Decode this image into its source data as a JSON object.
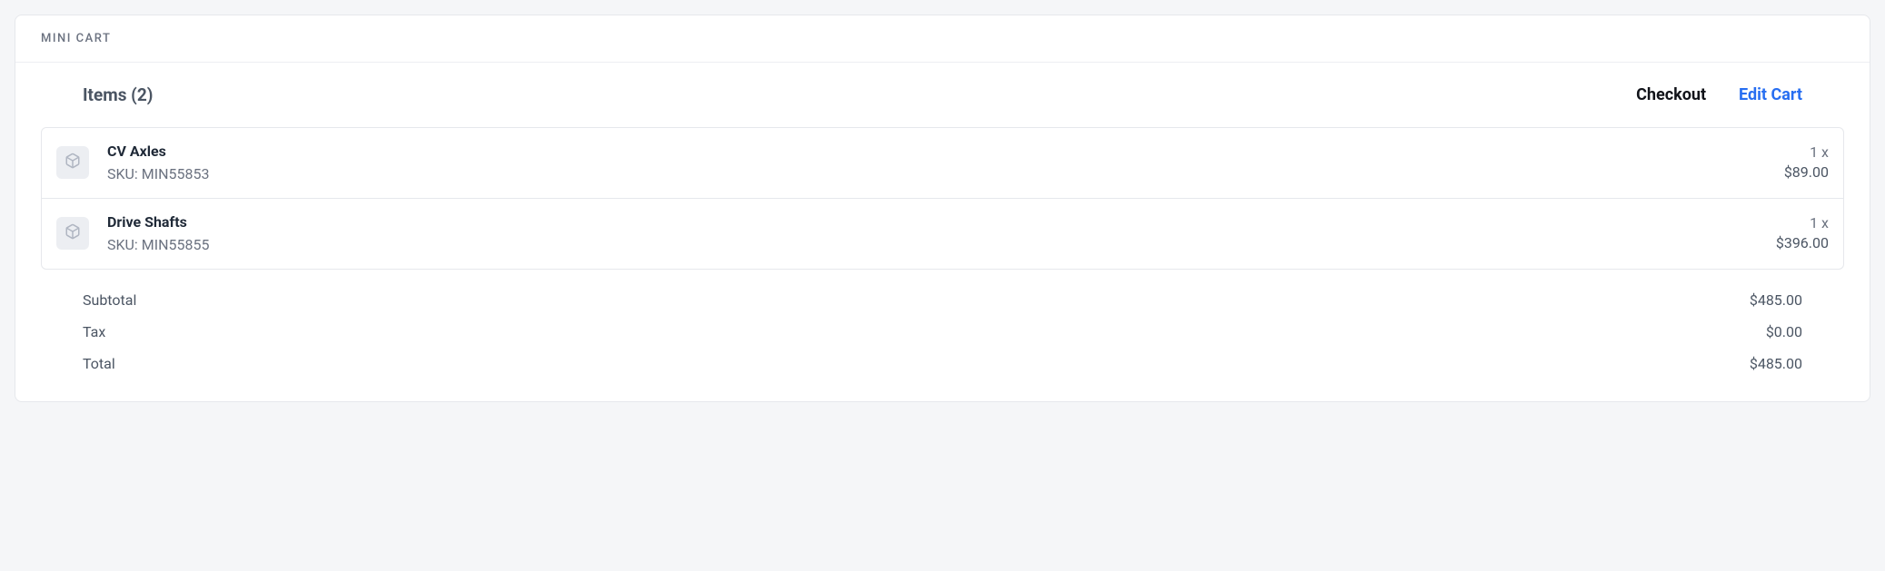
{
  "card": {
    "title": "Mini cart"
  },
  "header": {
    "items_label": "Items (2)",
    "checkout_label": "Checkout",
    "edit_label": "Edit Cart"
  },
  "items": [
    {
      "name": "CV Axles",
      "sku_line": "SKU: MIN55853",
      "qty": "1  x",
      "price": "$89.00"
    },
    {
      "name": "Drive Shafts",
      "sku_line": "SKU: MIN55855",
      "qty": "1  x",
      "price": "$396.00"
    }
  ],
  "summary": {
    "subtotal_label": "Subtotal",
    "subtotal_value": "$485.00",
    "tax_label": "Tax",
    "tax_value": "$0.00",
    "total_label": "Total",
    "total_value": "$485.00"
  }
}
